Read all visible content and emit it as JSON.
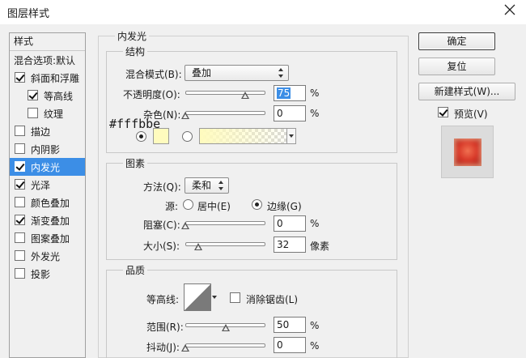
{
  "window": {
    "title": "图层样式"
  },
  "left_panel": {
    "header": "样式",
    "blend_options": "混合选项:默认",
    "items": [
      {
        "label": "斜面和浮雕",
        "checked": true,
        "indent": false
      },
      {
        "label": "等高线",
        "checked": true,
        "indent": true
      },
      {
        "label": "纹理",
        "checked": false,
        "indent": true
      },
      {
        "label": "描边",
        "checked": false,
        "indent": false
      },
      {
        "label": "内阴影",
        "checked": false,
        "indent": false
      },
      {
        "label": "内发光",
        "checked": true,
        "indent": false,
        "selected": true
      },
      {
        "label": "光泽",
        "checked": true,
        "indent": false
      },
      {
        "label": "颜色叠加",
        "checked": false,
        "indent": false
      },
      {
        "label": "渐变叠加",
        "checked": true,
        "indent": false
      },
      {
        "label": "图案叠加",
        "checked": false,
        "indent": false
      },
      {
        "label": "外发光",
        "checked": false,
        "indent": false
      },
      {
        "label": "投影",
        "checked": false,
        "indent": false
      }
    ]
  },
  "inner_glow": {
    "section_title": "内发光",
    "structure": {
      "title": "结构",
      "blend_mode_label": "混合模式(B):",
      "blend_mode_value": "叠加",
      "opacity_label": "不透明度(O):",
      "opacity_value": "75",
      "opacity_unit": "%",
      "noise_label": "杂色(N):",
      "noise_value": "0",
      "noise_unit": "%",
      "color_hex": "#fffbbe",
      "color_mode": "solid"
    },
    "elements": {
      "title": "图素",
      "technique_label": "方法(Q):",
      "technique_value": "柔和",
      "source_label": "源:",
      "source_center": "居中(E)",
      "source_edge": "边缘(G)",
      "source_selected": "edge",
      "choke_label": "阻塞(C):",
      "choke_value": "0",
      "choke_unit": "%",
      "size_label": "大小(S):",
      "size_value": "32",
      "size_unit": "像素"
    },
    "quality": {
      "title": "品质",
      "contour_label": "等高线:",
      "antialias_label": "消除锯齿(L)",
      "antialias_checked": false,
      "range_label": "范围(R):",
      "range_value": "50",
      "range_unit": "%",
      "jitter_label": "抖动(J):",
      "jitter_value": "0",
      "jitter_unit": "%"
    }
  },
  "buttons": {
    "ok": "确定",
    "reset": "复位",
    "new_style": "新建样式(W)...",
    "preview_label": "预览(V)",
    "preview_checked": true
  },
  "slider_levels": {
    "opacity": 0.75,
    "noise": 0,
    "choke": 0,
    "size": 0.16,
    "range": 0.5,
    "jitter": 0
  },
  "colors": {
    "glow": "#fffbbe",
    "selection": "#3c8ee6"
  },
  "icons": [
    "close-icon",
    "checkbox-icon",
    "radio-icon",
    "contour-icon"
  ]
}
